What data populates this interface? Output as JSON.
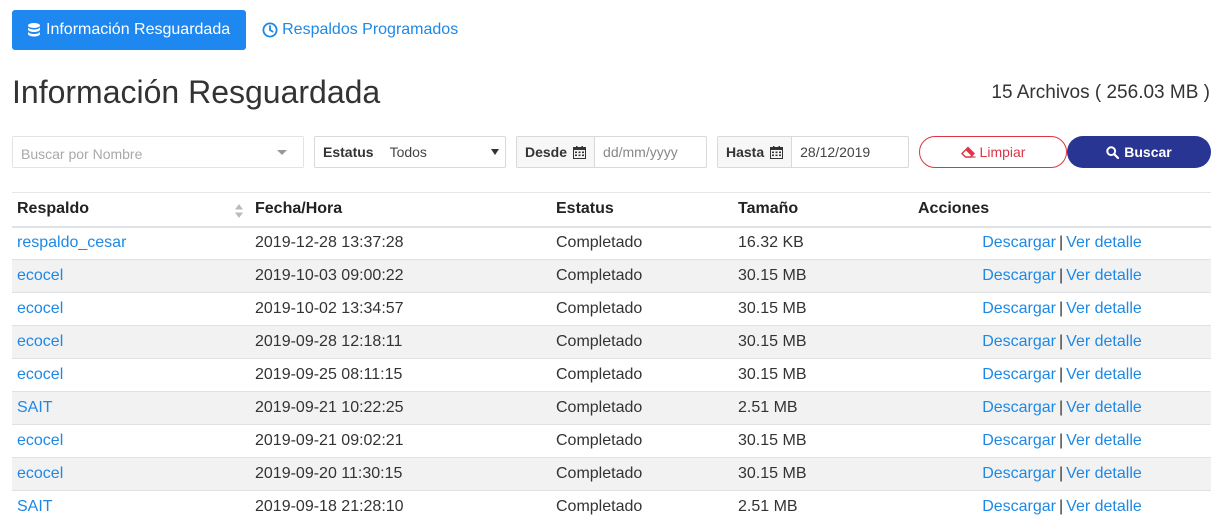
{
  "nav": {
    "active_tab": "Información Resguardada",
    "second_tab": "Respaldos Programados"
  },
  "page": {
    "title": "Información Resguardada",
    "summary": "15 Archivos ( 256.03 MB )"
  },
  "filters": {
    "search_placeholder": "Buscar por Nombre",
    "status_label": "Estatus",
    "status_value": "Todos",
    "from_label": "Desde",
    "from_placeholder": "dd/mm/yyyy",
    "to_label": "Hasta",
    "to_value": "28/12/2019",
    "clear_label": "Limpiar",
    "search_label": "Buscar"
  },
  "table": {
    "headers": [
      "Respaldo",
      "Fecha/Hora",
      "Estatus",
      "Tamaño",
      "Acciones"
    ],
    "action_download": "Descargar",
    "action_separator": "|",
    "action_detail": "Ver detalle",
    "rows": [
      {
        "name": "respaldo_cesar",
        "datetime": "2019-12-28 13:37:28",
        "status": "Completado",
        "size": "16.32 KB"
      },
      {
        "name": "ecocel",
        "datetime": "2019-10-03 09:00:22",
        "status": "Completado",
        "size": "30.15 MB"
      },
      {
        "name": "ecocel",
        "datetime": "2019-10-02 13:34:57",
        "status": "Completado",
        "size": "30.15 MB"
      },
      {
        "name": "ecocel",
        "datetime": "2019-09-28 12:18:11",
        "status": "Completado",
        "size": "30.15 MB"
      },
      {
        "name": "ecocel",
        "datetime": "2019-09-25 08:11:15",
        "status": "Completado",
        "size": "30.15 MB"
      },
      {
        "name": "SAIT",
        "datetime": "2019-09-21 10:22:25",
        "status": "Completado",
        "size": "2.51 MB"
      },
      {
        "name": "ecocel",
        "datetime": "2019-09-21 09:02:21",
        "status": "Completado",
        "size": "30.15 MB"
      },
      {
        "name": "ecocel",
        "datetime": "2019-09-20 11:30:15",
        "status": "Completado",
        "size": "30.15 MB"
      },
      {
        "name": "SAIT",
        "datetime": "2019-09-18 21:28:10",
        "status": "Completado",
        "size": "2.51 MB"
      }
    ]
  },
  "icons": {
    "active_tab_icon": "database-icon",
    "second_tab_icon": "clock-icon",
    "calendar": "calendar-icon",
    "clear": "eraser-icon",
    "search": "search-icon",
    "sort": "sort-icon"
  },
  "colors": {
    "primary": "#1e88f0",
    "link": "#1e88e5",
    "danger": "#dc3545",
    "search_button": "#283593"
  }
}
